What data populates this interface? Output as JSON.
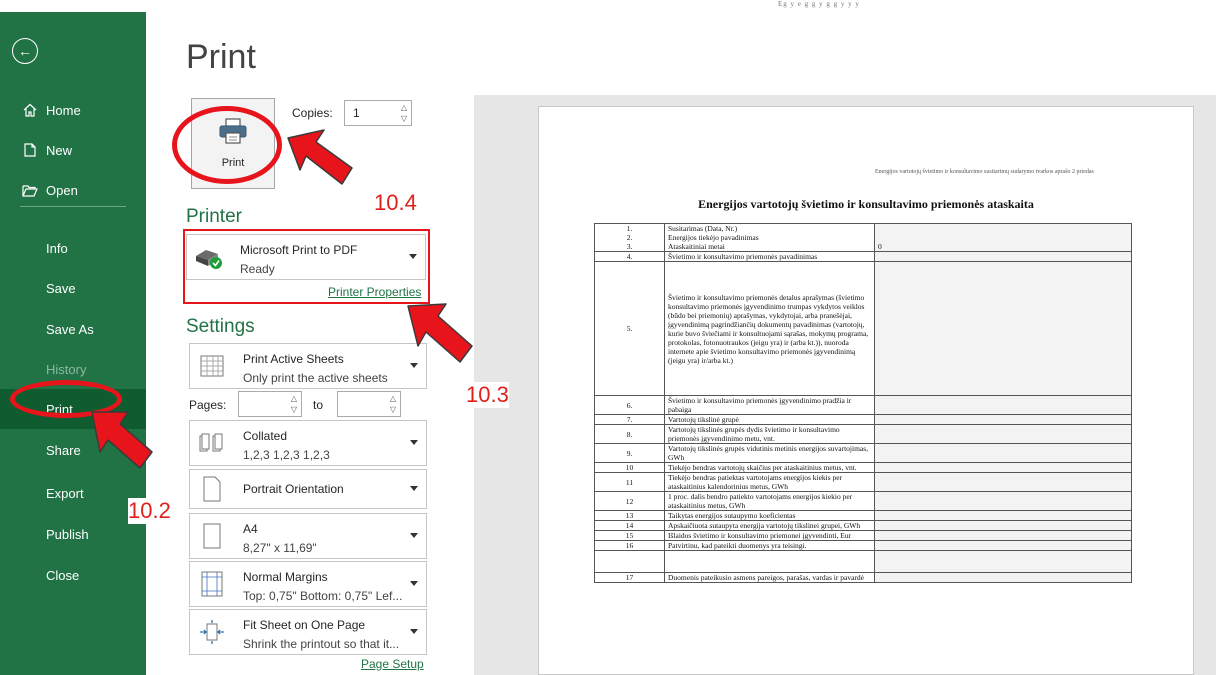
{
  "sidebar": {
    "items": [
      {
        "label": "Home",
        "icon": "home-icon"
      },
      {
        "label": "New",
        "icon": "new-document-icon"
      },
      {
        "label": "Open",
        "icon": "folder-open-icon"
      },
      {
        "label": "Info"
      },
      {
        "label": "Save"
      },
      {
        "label": "Save As"
      },
      {
        "label": "History",
        "disabled": true
      },
      {
        "label": "Print",
        "selected": true
      },
      {
        "label": "Share"
      },
      {
        "label": "Export"
      },
      {
        "label": "Publish"
      },
      {
        "label": "Close"
      }
    ]
  },
  "print_panel": {
    "title": "Print",
    "print_button_label": "Print",
    "copies_label": "Copies:",
    "copies_value": "1",
    "printer_heading": "Printer",
    "printer_name": "Microsoft Print to PDF",
    "printer_status": "Ready",
    "printer_properties_link": "Printer Properties",
    "settings_heading": "Settings",
    "settings": {
      "scope": {
        "title": "Print Active Sheets",
        "subtitle": "Only print the active sheets"
      },
      "pages_label": "Pages:",
      "pages_from": "",
      "to_label": "to",
      "pages_to": "",
      "collation": {
        "title": "Collated",
        "subtitle": "1,2,3    1,2,3    1,2,3"
      },
      "orientation": {
        "title": "Portrait Orientation"
      },
      "paper": {
        "title": "A4",
        "subtitle": "8,27\" x 11,69\""
      },
      "margins": {
        "title": "Normal Margins",
        "subtitle": "Top: 0,75\" Bottom: 0,75\" Lef..."
      },
      "scaling": {
        "title": "Fit Sheet on One Page",
        "subtitle": "Shrink the printout so that it..."
      }
    },
    "page_setup_link": "Page Setup"
  },
  "annotations": {
    "step_10_2": "10.2",
    "step_10_3": "10.3",
    "step_10_4": "10.4",
    "accent_color": "#e8141c"
  },
  "preview": {
    "top_strip": "Eg  y       e     g        g    y   g    g    y  y  y",
    "note": "Energijos vartotojų švietimo ir konsultavimo susitarimų sudarymo tvarkos aprašo 2 priedas",
    "title": "Energijos vartotojų švietimo ir konsultavimo priemonės ataskaita",
    "rows": [
      {
        "num": "1.\n2.\n3.",
        "label": "Susitarimas (Data, Nr.)\nEnergijos tiekėjo pavadinimas\nAtaskaitiniai metai",
        "value": "\n\n0"
      },
      {
        "num": "4.",
        "label": "Švietimo ir konsultavimo priemonės pavadinimas",
        "value": ""
      },
      {
        "num": "5.",
        "label": "Švietimo ir konsultavimo priemonės detalus aprašymas (švietimo konsultavimo priemonės įgyvendinimo trumpas vykdytos veiklos (būdo bei priemonių) aprašymas, vykdytojai, arba pranešėjai, įgyvendinimą pagrindžiančių dokumentų pavadinimas (vartotojų, kurie buvo šviečiami ir konsultuojami sąrašas, mokymų programa, protokolas, fotonuotraukos (jeigu yra) ir (arba kt.)), nuoroda internete apie švietimo konsultavimo priemonės įgyvendinimą (jeigu yra) ir/arba kt.)",
        "value": ""
      },
      {
        "num": "6.",
        "label": "Švietimo ir konsultavimo priemonės įgyvendinimo pradžia ir pabaiga",
        "value": ""
      },
      {
        "num": "7.",
        "label": "Vartotojų tikslinė grupė",
        "value": ""
      },
      {
        "num": "8.",
        "label": "Vartotojų tikslinės grupės dydis švietimo ir konsultavimo priemonės įgyvendinimo metu, vnt.",
        "value": ""
      },
      {
        "num": "9.",
        "label": "Vartotojų tikslinės grupės vidutinis metinis energijos suvartojimas, GWh",
        "value": ""
      },
      {
        "num": "10",
        "label": "Tiekėjo bendras vartotojų skaičius per ataskaitinius metus, vnt.",
        "value": ""
      },
      {
        "num": "11",
        "label": "Tiekėjo bendras patiektas vartotojams energijos kiekis per ataskaitinius kalendorinius metus, GWh",
        "value": ""
      },
      {
        "num": "12",
        "label": "1 proc. dalis bendro patiekto vartotojams energijos kiekio per ataskaitinius metus, GWh",
        "value": ""
      },
      {
        "num": "13",
        "label": "Taikytas energijos sutaupymo koeficientas",
        "value": ""
      },
      {
        "num": "14",
        "label": "Apskaičiuota sutaupyta energija vartotojų tikslinei grupei, GWh",
        "value": ""
      },
      {
        "num": "15",
        "label": "Išlaidos švietimo ir konsultavimo priemonei įgyvendinti, Eur",
        "value": ""
      },
      {
        "num": "16",
        "label": "Patvirtinu, kad pateikti duomenys yra teisingi.",
        "value": ""
      },
      {
        "num": "",
        "label": "",
        "value": ""
      },
      {
        "num": "17",
        "label": "Duomenis pateikusio asmens pareigos, parašas, vardas ir pavardė",
        "value": ""
      }
    ]
  }
}
